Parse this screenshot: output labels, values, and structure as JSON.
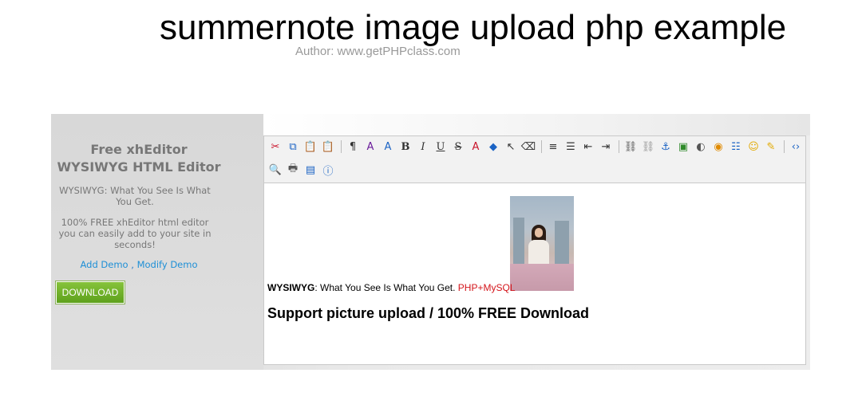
{
  "page": {
    "title": "summernote image upload php example",
    "author": "Author: www.getPHPclass.com"
  },
  "sidebar": {
    "heading_line1": "Free xhEditor",
    "heading_line2": "WYSIWYG HTML Editor",
    "text1": "WYSIWYG: What You See Is What You Get.",
    "text2": "100% FREE xhEditor html editor you can easily add to your site in seconds!",
    "link_add": "Add Demo",
    "link_sep": " , ",
    "link_modify": "Modify Demo",
    "download_label": "DOWNLOAD"
  },
  "toolbar": {
    "row1": [
      {
        "name": "cut-icon",
        "glyph": "✂",
        "color": "#c9142b"
      },
      {
        "name": "copy-icon",
        "glyph": "⧉",
        "color": "#1b63c4"
      },
      {
        "name": "paste-icon",
        "glyph": "📋",
        "color": "#8a6a2a"
      },
      {
        "name": "paste-text-icon",
        "glyph": "📋",
        "color": "#8a6a2a"
      },
      {
        "name": "separator",
        "glyph": ""
      },
      {
        "name": "block-format-icon",
        "glyph": "¶",
        "color": "#333"
      },
      {
        "name": "font-family-icon",
        "glyph": "A",
        "color": "#6a1b9a"
      },
      {
        "name": "font-size-icon",
        "glyph": "A",
        "color": "#1b63c4"
      },
      {
        "name": "bold-icon",
        "glyph": "B",
        "cls": "bold"
      },
      {
        "name": "italic-icon",
        "glyph": "I",
        "cls": "ital"
      },
      {
        "name": "underline-icon",
        "glyph": "U",
        "cls": "und"
      },
      {
        "name": "strikethrough-icon",
        "glyph": "S",
        "cls": "strk"
      },
      {
        "name": "font-color-icon",
        "glyph": "A",
        "color": "#c9142b"
      },
      {
        "name": "back-color-icon",
        "glyph": "◆",
        "color": "#1b63c4"
      },
      {
        "name": "select-all-icon",
        "glyph": "↖",
        "color": "#333"
      },
      {
        "name": "remove-format-icon",
        "glyph": "⌫",
        "color": "#333"
      },
      {
        "name": "separator",
        "glyph": ""
      },
      {
        "name": "align-icon",
        "glyph": "≡",
        "color": "#333"
      },
      {
        "name": "list-icon",
        "glyph": "☰",
        "color": "#333"
      },
      {
        "name": "outdent-icon",
        "glyph": "⇤",
        "color": "#333"
      },
      {
        "name": "indent-icon",
        "glyph": "⇥",
        "color": "#333"
      },
      {
        "name": "separator",
        "glyph": ""
      },
      {
        "name": "link-icon",
        "glyph": "⛓",
        "color": "#555"
      },
      {
        "name": "unlink-icon",
        "glyph": "⛓",
        "color": "#999"
      },
      {
        "name": "anchor-icon",
        "glyph": "⚓",
        "color": "#1b63c4"
      },
      {
        "name": "image-icon",
        "glyph": "▣",
        "color": "#2f8a2a"
      },
      {
        "name": "flash-icon",
        "glyph": "◐",
        "color": "#555"
      },
      {
        "name": "media-icon",
        "glyph": "◉",
        "color": "#e08a00"
      },
      {
        "name": "hr-icon",
        "glyph": "☷",
        "color": "#1b63c4"
      },
      {
        "name": "emoticon-icon",
        "glyph": "☺",
        "color": "#e2a900"
      },
      {
        "name": "table-icon",
        "glyph": "✎",
        "color": "#e2a900"
      },
      {
        "name": "separator",
        "glyph": ""
      },
      {
        "name": "source-icon",
        "glyph": "‹›",
        "color": "#1b63c4"
      }
    ],
    "row2": [
      {
        "name": "preview-icon",
        "glyph": "🔍",
        "color": "#555"
      },
      {
        "name": "print-icon",
        "glyph": "🖶",
        "color": "#555"
      },
      {
        "name": "fullscreen-icon",
        "glyph": "▤",
        "color": "#1b63c4"
      },
      {
        "name": "about-icon",
        "glyph": "ⓘ",
        "color": "#1b63c4"
      }
    ]
  },
  "content": {
    "inline_bold": "WYSIWYG",
    "inline_rest": ": What You See Is What You Get. ",
    "inline_red": "PHP+MySQL",
    "big_line": "Support picture upload / 100% FREE Download"
  },
  "colors": {
    "link": "#1e8fd6",
    "download_green": "#5ea11c",
    "accent_red": "#d4141a"
  }
}
